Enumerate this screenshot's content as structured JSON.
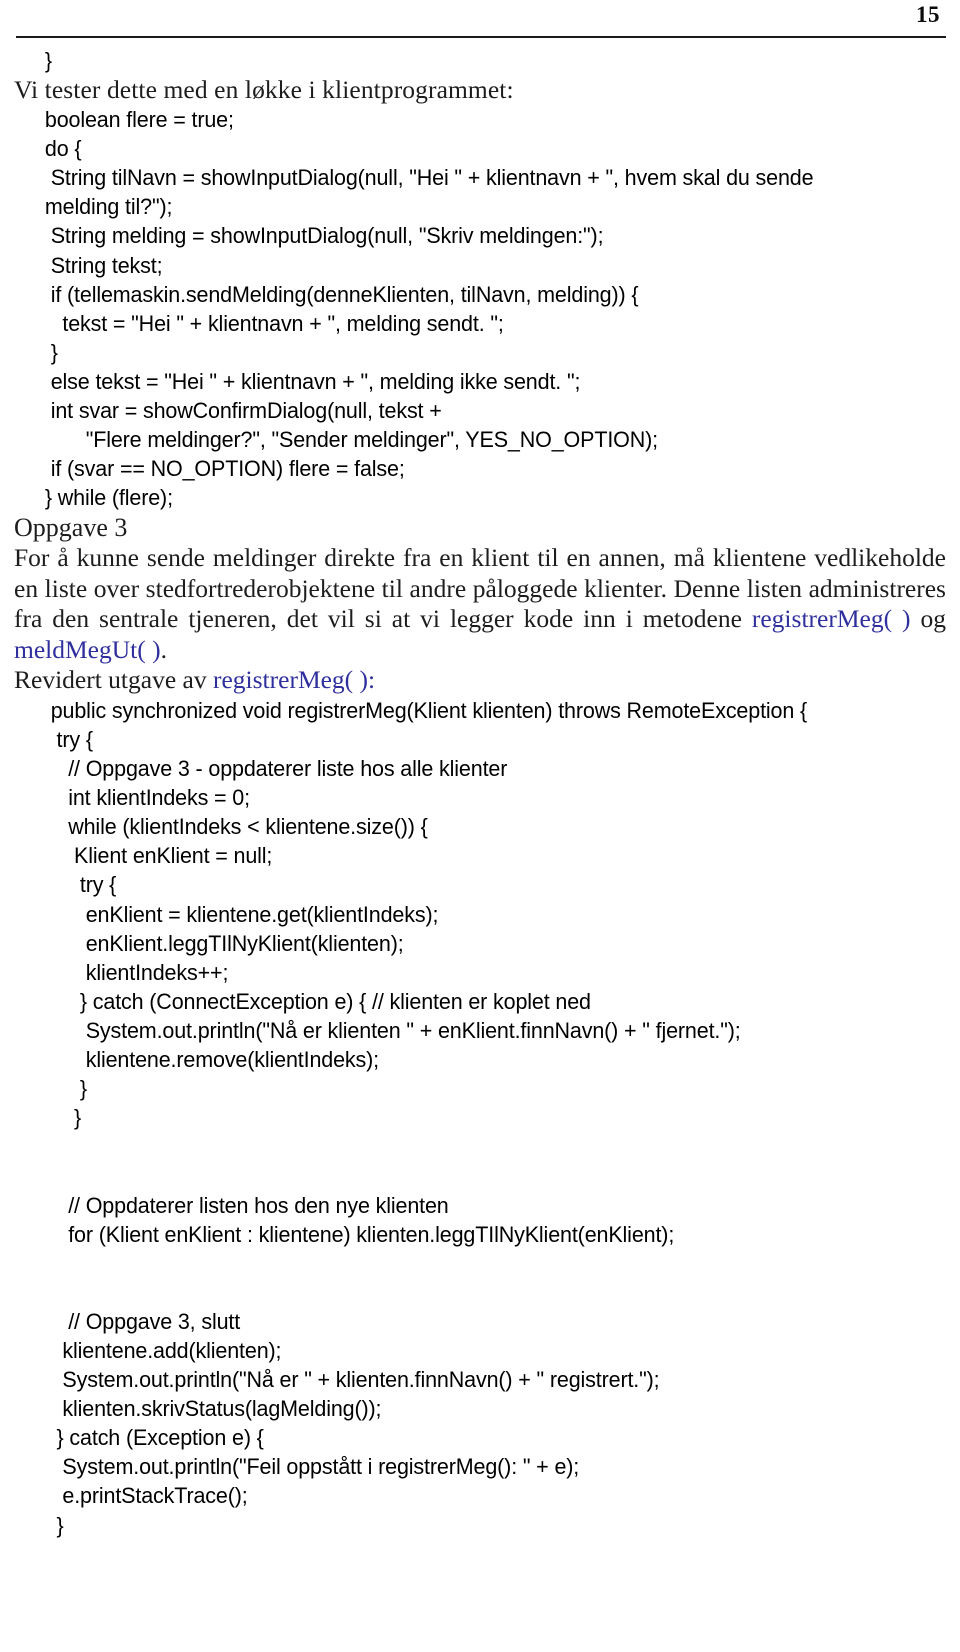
{
  "header": {
    "page_number": "15"
  },
  "blocks": [
    {
      "kind": "code",
      "text": "}"
    },
    {
      "kind": "prose",
      "text": "Vi tester dette med en løkke i klientprogrammet:"
    },
    {
      "kind": "code",
      "text": "boolean flere = true;"
    },
    {
      "kind": "code",
      "text": "do {"
    },
    {
      "kind": "code",
      "text": " String tilNavn = showInputDialog(null, \"Hei \" + klientnavn + \", hvem skal du sende"
    },
    {
      "kind": "code",
      "text": "melding til?\");"
    },
    {
      "kind": "code",
      "text": " String melding = showInputDialog(null, \"Skriv meldingen:\");"
    },
    {
      "kind": "code",
      "text": " String tekst;"
    },
    {
      "kind": "code",
      "text": " if (tellemaskin.sendMelding(denneKlienten, tilNavn, melding)) {"
    },
    {
      "kind": "code",
      "text": "   tekst = \"Hei \" + klientnavn + \", melding sendt. \";"
    },
    {
      "kind": "code",
      "text": " }"
    },
    {
      "kind": "code",
      "text": " else tekst = \"Hei \" + klientnavn + \", melding ikke sendt. \";"
    },
    {
      "kind": "code",
      "text": " int svar = showConfirmDialog(null, tekst +"
    },
    {
      "kind": "code",
      "text": "       \"Flere meldinger?\", \"Sender meldinger\", YES_NO_OPTION);"
    },
    {
      "kind": "code",
      "text": " if (svar == NO_OPTION) flere = false;"
    },
    {
      "kind": "code",
      "text": "} while (flere);"
    },
    {
      "kind": "heading",
      "text": "Oppgave 3"
    },
    {
      "kind": "paragraph",
      "runs": [
        {
          "text": "For å kunne sende meldinger direkte fra en klient til en annen, må klientene vedlikeholde en liste over stedfortrederobjektene til andre påloggede klienter. Denne listen administreres fra den sentrale tjeneren, det vil si at vi legger kode inn i metodene "
        },
        {
          "text": "registrerMeg( )",
          "style": "link"
        },
        {
          "text": " og "
        },
        {
          "text": "meldMegUt( )",
          "style": "link"
        },
        {
          "text": "."
        }
      ]
    },
    {
      "kind": "paragraph",
      "runs": [
        {
          "text": "Revidert utgave av "
        },
        {
          "text": "registrerMeg( ):",
          "style": "link"
        }
      ]
    },
    {
      "kind": "code",
      "text": " public synchronized void registrerMeg(Klient klienten) throws RemoteException {"
    },
    {
      "kind": "code",
      "text": "  try {"
    },
    {
      "kind": "code",
      "text": "    // Oppgave 3 - oppdaterer liste hos alle klienter"
    },
    {
      "kind": "code",
      "text": "    int klientIndeks = 0;"
    },
    {
      "kind": "code",
      "text": "    while (klientIndeks < klientene.size()) {"
    },
    {
      "kind": "code",
      "text": "     Klient enKlient = null;"
    },
    {
      "kind": "code",
      "text": "      try {"
    },
    {
      "kind": "code",
      "text": "       enKlient = klientene.get(klientIndeks);"
    },
    {
      "kind": "code",
      "text": "       enKlient.leggTIlNyKlient(klienten);"
    },
    {
      "kind": "code",
      "text": "       klientIndeks++;"
    },
    {
      "kind": "code",
      "text": "      } catch (ConnectException e) { // klienten er koplet ned"
    },
    {
      "kind": "code",
      "text": "       System.out.println(\"Nå er klienten \" + enKlient.finnNavn() + \" fjernet.\");"
    },
    {
      "kind": "code",
      "text": "       klientene.remove(klientIndeks);"
    },
    {
      "kind": "code",
      "text": "      }"
    },
    {
      "kind": "code",
      "text": "     }"
    },
    {
      "kind": "code",
      "text": ""
    },
    {
      "kind": "code",
      "text": ""
    },
    {
      "kind": "code",
      "text": "    // Oppdaterer listen hos den nye klienten"
    },
    {
      "kind": "code",
      "text": "    for (Klient enKlient : klientene) klienten.leggTIlNyKlient(enKlient);"
    },
    {
      "kind": "code",
      "text": ""
    },
    {
      "kind": "code",
      "text": ""
    },
    {
      "kind": "code",
      "text": "    // Oppgave 3, slutt"
    },
    {
      "kind": "code",
      "text": "   klientene.add(klienten);"
    },
    {
      "kind": "code",
      "text": "   System.out.println(\"Nå er \" + klienten.finnNavn() + \" registrert.\");"
    },
    {
      "kind": "code",
      "text": "   klienten.skrivStatus(lagMelding());"
    },
    {
      "kind": "code",
      "text": "  } catch (Exception e) {"
    },
    {
      "kind": "code",
      "text": "   System.out.println(\"Feil oppstått i registrerMeg(): \" + e);"
    },
    {
      "kind": "code",
      "text": "   e.printStackTrace();"
    },
    {
      "kind": "code",
      "text": "  }"
    }
  ],
  "colors": {
    "link": "#2f2f9e",
    "text": "#000000",
    "prose": "#1d1d1d",
    "rule": "#1a1a1a",
    "background": "#ffffff"
  }
}
